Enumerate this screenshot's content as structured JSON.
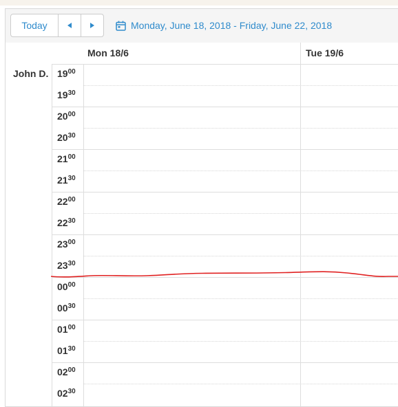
{
  "toolbar": {
    "today_label": "Today",
    "prev_icon": "caret-left-icon",
    "next_icon": "caret-right-icon",
    "calendar_icon": "calendar-icon",
    "date_range": "Monday, June 18, 2018 - Friday, June 22, 2018"
  },
  "days": [
    {
      "label": "Mon 18/6"
    },
    {
      "label": "Tue 19/6"
    }
  ],
  "resources": [
    {
      "name": "John D."
    }
  ],
  "time_slots": [
    {
      "hour": "19",
      "minute": "00"
    },
    {
      "hour": "19",
      "minute": "30"
    },
    {
      "hour": "20",
      "minute": "00"
    },
    {
      "hour": "20",
      "minute": "30"
    },
    {
      "hour": "21",
      "minute": "00"
    },
    {
      "hour": "21",
      "minute": "30"
    },
    {
      "hour": "22",
      "minute": "00"
    },
    {
      "hour": "22",
      "minute": "30"
    },
    {
      "hour": "23",
      "minute": "00"
    },
    {
      "hour": "23",
      "minute": "30"
    },
    {
      "hour": "00",
      "minute": "00"
    },
    {
      "hour": "00",
      "minute": "30"
    },
    {
      "hour": "01",
      "minute": "00"
    },
    {
      "hour": "01",
      "minute": "30"
    },
    {
      "hour": "02",
      "minute": "00"
    },
    {
      "hour": "02",
      "minute": "30"
    }
  ],
  "colors": {
    "accent": "#2f8bcc",
    "now_indicator": "#e02020",
    "grid_line": "#dddddd",
    "toolbar_bg": "#f5f5f5"
  }
}
